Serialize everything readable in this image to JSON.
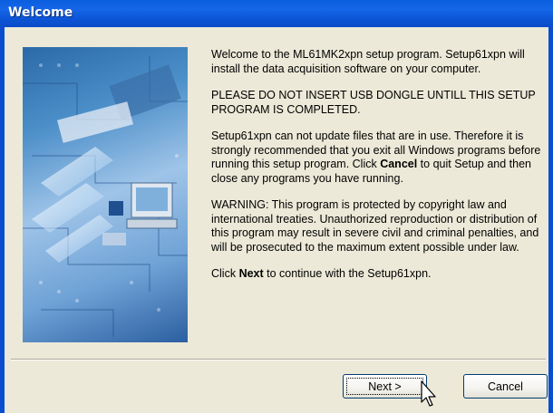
{
  "window": {
    "title": "Welcome"
  },
  "content": {
    "para1": "Welcome to the ML61MK2xpn setup program.  Setup61xpn will install the data acquisition software on your computer.",
    "para2": "PLEASE DO NOT INSERT USB DONGLE UNTILL THIS SETUP PROGRAM IS COMPLETED.",
    "para3": {
      "before": "Setup61xpn can not update files that are in use.  Therefore it is strongly recommended that you exit all Windows programs before running this setup program.  Click ",
      "bold": "Cancel",
      "after": " to quit Setup and then close any programs you have running."
    },
    "para4": "WARNING:  This program is protected by copyright law and international treaties.  Unauthorized reproduction or distribution of this program may result in severe civil and criminal penalties, and will be prosecuted to the maximum extent possible under law.",
    "para5": {
      "before": "Click ",
      "bold": "Next",
      "after": " to continue with the Setup61xpn."
    }
  },
  "buttons": {
    "next_label": "Next >",
    "cancel_label": "Cancel"
  },
  "colors": {
    "titlebar": "#0a5fde",
    "dialog_bg": "#ece9d8"
  },
  "icons": {
    "cursor": "mouse-pointer-icon"
  }
}
